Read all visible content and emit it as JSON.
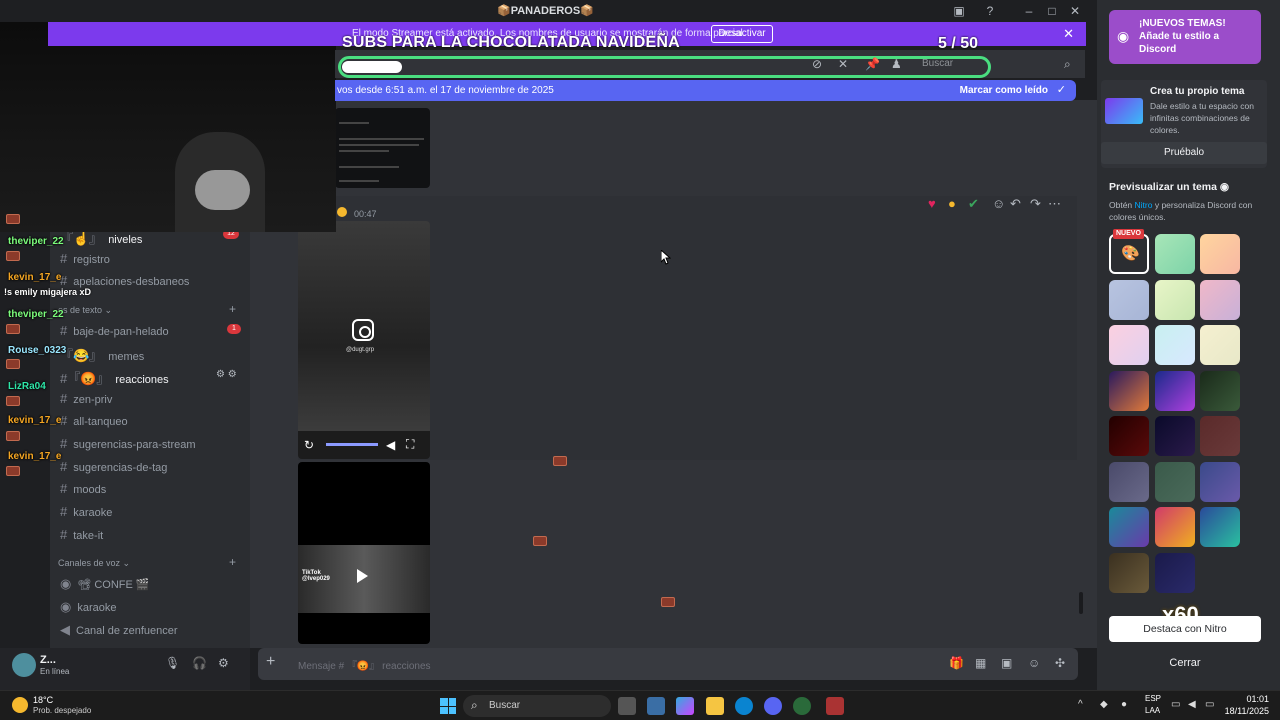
{
  "window": {
    "title": "📦PANADEROS📦"
  },
  "streamer_banner": {
    "text": "El modo Streamer está activado. Los nombres de usuario se mostrarán de forma parcial.",
    "button": "Desactivar"
  },
  "overlay": {
    "title": "SUBS PARA LA CHOCOLATADA NAVIDEÑA",
    "count": "5 / 50"
  },
  "header": {
    "search_placeholder": "Buscar"
  },
  "new_messages": {
    "text": "vos desde 6:51 a.m. el 17 de noviembre de 2025",
    "mark_read": "Marcar como leído"
  },
  "message": {
    "time": "00:47",
    "instagram_handle": "@dugt.grp"
  },
  "tiktok": {
    "label": "TikTok",
    "handle": "@lvep029"
  },
  "channels": [
    {
      "name": "niveles",
      "prefix": "『☝』",
      "bold": true,
      "badge": "12"
    },
    {
      "name": "registro",
      "prefix": "#",
      "bold": false
    },
    {
      "name": "apelaciones-desbaneos",
      "prefix": "#",
      "bold": false
    },
    {
      "name": "baje-de-pan-helado",
      "prefix": "#",
      "bold": false,
      "badge": "1"
    },
    {
      "name": "memes",
      "prefix": "『😂』",
      "bold": false
    },
    {
      "name": "reacciones",
      "prefix": "#『😡』",
      "bold": true
    },
    {
      "name": "zen-priv",
      "prefix": "#",
      "bold": false
    },
    {
      "name": "all-tanqueo",
      "prefix": "#",
      "bold": false
    },
    {
      "name": "sugerencias-para-stream",
      "prefix": "#",
      "bold": false
    },
    {
      "name": "sugerencias-de-tag",
      "prefix": "#",
      "bold": false
    },
    {
      "name": "moods",
      "prefix": "#",
      "bold": false
    },
    {
      "name": "karaoke",
      "prefix": "#",
      "bold": false
    },
    {
      "name": "take-it",
      "prefix": "#",
      "bold": false
    }
  ],
  "sections": {
    "text": "es de texto",
    "voice": "Canales de voz"
  },
  "voice_channels": [
    {
      "name": "📽 CONFE 🎬"
    },
    {
      "name": "karaoke"
    },
    {
      "name": "Canal de zenfuencer"
    }
  ],
  "chat_overlay": [
    {
      "name": "theviper_22",
      "color": "#7CFC7C"
    },
    {
      "name": "kevin_17_e",
      "color": "#f5a623"
    },
    {
      "message": "!s emily migajera xD"
    },
    {
      "name": "theviper_22",
      "color": "#7CFC7C"
    },
    {
      "name": "Rouse_0323",
      "color": "#9be7ff"
    },
    {
      "name": "LizRa04",
      "color": "#2ee6a8"
    },
    {
      "name": "kevin_17_e",
      "color": "#f5a623"
    },
    {
      "name": "kevin_17_e",
      "color": "#f5a623"
    }
  ],
  "user": {
    "name": "Z...",
    "status": "En línea"
  },
  "input": {
    "placeholder": "Mensaje # 『😡』 reacciones"
  },
  "right_panel": {
    "promo": "¡NUEVOS TEMAS! Añade tu estilo a Discord",
    "create_title": "Crea tu propio tema",
    "create_desc": "Dale estilo a tu espacio con infinitas combinaciones de colores.",
    "try_button": "Pruébalo",
    "preview_title": "Previsualizar un tema",
    "preview_desc_pre": "Obtén ",
    "preview_desc_link": "Nitro",
    "preview_desc_post": " y personaliza Discord con colores únicos.",
    "new_badge": "NUEVO",
    "swatches": [
      "#2b2d31",
      "linear-gradient(135deg,#a8e6b8,#7dd3a8)",
      "linear-gradient(135deg,#ffd59e,#f7b7a3)",
      "linear-gradient(135deg,#b8c4e0,#a7b5d6)",
      "linear-gradient(135deg,#e8f5c8,#c8e6b0)",
      "linear-gradient(135deg,#f0b8c8,#c8b0d8)",
      "linear-gradient(135deg,#fcd0e0,#e0d0f0)",
      "linear-gradient(135deg,#c8f0f0,#d8e8ff)",
      "linear-gradient(135deg,#f5f0d0,#e8e8c8)",
      "linear-gradient(135deg,#2a1a5e,#e07a3a)",
      "linear-gradient(135deg,#1a2a8a,#b040e0)",
      "linear-gradient(135deg,#1a2a1a,#3a5a3a)",
      "linear-gradient(135deg,#200,#5a0a0a)",
      "linear-gradient(135deg,#0a0a2a,#2a1a4a)",
      "linear-gradient(135deg,#5a2a2a,#6a3a3a)",
      "linear-gradient(135deg,#4a4a6a,#6a6a8a)",
      "linear-gradient(135deg,#3a5a4a,#4a6a5a)",
      "linear-gradient(135deg,#3a4a8a,#6a5aaa)",
      "linear-gradient(135deg,#1a8a9a,#6a3aaa)",
      "linear-gradient(135deg,#d03a6a,#f0b020)",
      "linear-gradient(135deg,#2a4a9a,#2ac0a0)",
      "linear-gradient(135deg,#3a3020,#6a5a3a)",
      "linear-gradient(135deg,#1a1a4a,#2a2a6a)"
    ],
    "boost_text": "x60",
    "nitro_button": "Destaca con Nitro",
    "close_button": "Cerrar"
  },
  "taskbar": {
    "temp": "18°C",
    "weather": "Prob. despejado",
    "search": "Buscar",
    "lang1": "ESP",
    "lang2": "LAA",
    "time": "01:01",
    "date": "18/11/2025"
  }
}
